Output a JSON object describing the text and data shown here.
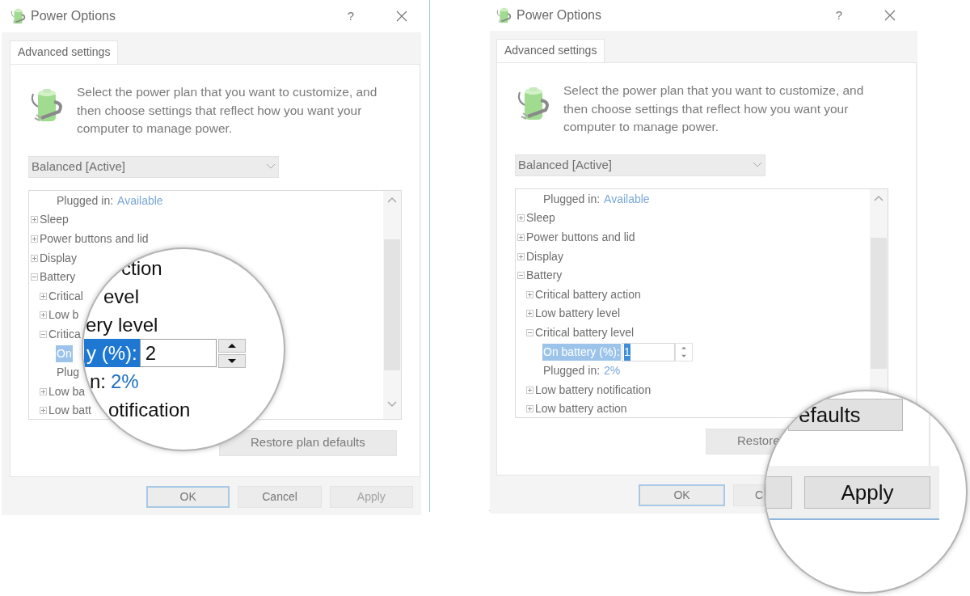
{
  "dialogs": [
    {
      "title": "Power Options",
      "help": "?",
      "tab": {
        "label": "Advanced settings",
        "selected": true
      },
      "description": "Select the power plan that you want to customize, and then choose settings that reflect how you want your computer to manage power.",
      "plan": "Balanced [Active]",
      "scroll_down_visible": true,
      "tree": [
        {
          "kind": "value",
          "label": "Plugged in:",
          "value": "Available"
        },
        {
          "kind": "node",
          "label": "Sleep",
          "expanded": false
        },
        {
          "kind": "node",
          "label": "Power buttons and lid",
          "expanded": false
        },
        {
          "kind": "node",
          "label": "Display",
          "expanded": false
        },
        {
          "kind": "node",
          "label": "Battery",
          "expanded": true,
          "children": [
            {
              "kind": "node",
              "label": "Critical",
              "expanded": false
            },
            {
              "kind": "node",
              "label": "Low b",
              "expanded": false
            },
            {
              "kind": "node",
              "label": "Critica",
              "expanded": true,
              "children": [
                {
                  "kind": "edit",
                  "label": "On",
                  "selected": true
                },
                {
                  "kind": "value",
                  "label": "Plug"
                }
              ]
            },
            {
              "kind": "node",
              "label": "Low ba",
              "expanded": false
            },
            {
              "kind": "node",
              "label": "Low batt",
              "expanded": false
            }
          ]
        }
      ],
      "restore_button": "Restore plan defaults",
      "buttons": [
        {
          "label": "OK",
          "focused": true,
          "disabled": false
        },
        {
          "label": "Cancel",
          "focused": false,
          "disabled": false
        },
        {
          "label": "Apply",
          "focused": false,
          "disabled": true
        }
      ],
      "magnifier": {
        "kind": "tree",
        "rows": [
          {
            "kind": "text",
            "label": "ction"
          },
          {
            "kind": "text",
            "label": "evel"
          },
          {
            "kind": "text",
            "label": "ery level"
          },
          {
            "kind": "edit",
            "label": "y (%):",
            "value": "2",
            "selected": true
          },
          {
            "kind": "value",
            "label": "n:",
            "value": "2%"
          },
          {
            "kind": "text",
            "label": "otification"
          }
        ]
      }
    },
    {
      "title": "Power Options",
      "help": "?",
      "tab": {
        "label": "Advanced settings",
        "selected": true
      },
      "description": "Select the power plan that you want to customize, and then choose settings that reflect how you want your computer to manage power.",
      "plan": "Balanced [Active]",
      "scroll_down_visible": false,
      "tree": [
        {
          "kind": "value",
          "label": "Plugged in:",
          "value": "Available"
        },
        {
          "kind": "node",
          "label": "Sleep",
          "expanded": false
        },
        {
          "kind": "node",
          "label": "Power buttons and lid",
          "expanded": false
        },
        {
          "kind": "node",
          "label": "Display",
          "expanded": false
        },
        {
          "kind": "node",
          "label": "Battery",
          "expanded": true,
          "children": [
            {
              "kind": "node",
              "label": "Critical battery action",
              "expanded": false
            },
            {
              "kind": "node",
              "label": "Low battery level",
              "expanded": false
            },
            {
              "kind": "node",
              "label": "Critical battery level",
              "expanded": true,
              "children": [
                {
                  "kind": "edit",
                  "label": "On battery (%):",
                  "value": "1",
                  "selected": true
                },
                {
                  "kind": "value",
                  "label": "Plugged in:",
                  "value": "2%"
                }
              ]
            },
            {
              "kind": "node",
              "label": "Low battery notification",
              "expanded": false
            },
            {
              "kind": "node",
              "label": "Low battery action",
              "expanded": false
            }
          ]
        }
      ],
      "restore_button": "Restore",
      "buttons": [
        {
          "label": "OK",
          "focused": true,
          "disabled": false
        },
        {
          "label": "C",
          "focused": false,
          "disabled": false
        }
      ],
      "magnifier": {
        "kind": "buttons",
        "restore": "efaults",
        "buttons": [
          {
            "kind": "fragment"
          },
          {
            "kind": "button",
            "label": "Apply",
            "disabled": false
          }
        ]
      }
    }
  ]
}
